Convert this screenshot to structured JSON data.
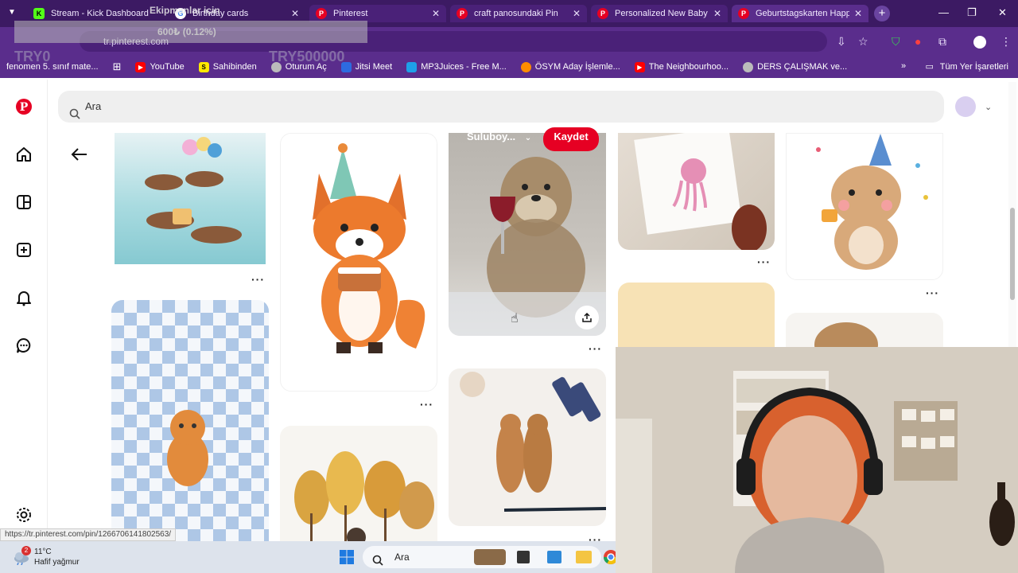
{
  "browser": {
    "tabs": [
      {
        "title": "Stream - Kick Dashboard",
        "fav_letter": "K",
        "fav_color": "#53fc18"
      },
      {
        "title": "Birthday cards",
        "fav_letter": "G",
        "fav_color": "#ffffff"
      },
      {
        "title": "Pinterest",
        "fav_letter": "P",
        "fav_color": "#e60023"
      },
      {
        "title": "craft panosundaki Pin",
        "fav_letter": "P",
        "fav_color": "#e60023"
      },
      {
        "title": "Personalized New Baby Ca",
        "fav_letter": "P",
        "fav_color": "#e60023"
      },
      {
        "title": "Geburtstagskarten Happy",
        "fav_letter": "P",
        "fav_color": "#e60023"
      }
    ],
    "omnibox_text": "tr.pinterest.com",
    "bookmarks": [
      {
        "label": "fenomen 5. sınıf mate...",
        "fav_color": "#ffcc00",
        "letter": ""
      },
      {
        "label": "YouTube",
        "fav_color": "#ff0000",
        "letter": "▶"
      },
      {
        "label": "Sahibinden",
        "fav_color": "#ffe800",
        "letter": "S"
      },
      {
        "label": "Oturum Aç",
        "fav_color": "#cccccc",
        "letter": ""
      },
      {
        "label": "Jitsi Meet",
        "fav_color": "#2d6be0",
        "letter": ""
      },
      {
        "label": "MP3Juices - Free M...",
        "fav_color": "#1ea0e8",
        "letter": ""
      },
      {
        "label": "ÖSYM Aday İşlemle...",
        "fav_color": "#ff8c00",
        "letter": ""
      },
      {
        "label": "The Neighbourhoo...",
        "fav_color": "#ff0000",
        "letter": "▶"
      },
      {
        "label": "DERS ÇALIŞMAK ve...",
        "fav_color": "#cccccc",
        "letter": ""
      }
    ],
    "all_bookmarks": "Tüm Yer İşaretleri"
  },
  "overlay": {
    "heading": "Ekipmanlar için",
    "amount": "600₺ (0.12%)",
    "left_value": "TRY0",
    "right_value": "TRY500000"
  },
  "pinterest": {
    "search_placeholder": "Ara",
    "save_label": "Kaydet",
    "board_name": "Suluboy...",
    "status_url": "https://tr.pinterest.com/pin/1266706141802563/"
  },
  "taskbar": {
    "temperature": "11°C",
    "weather": "Hafif yağmur",
    "search_label": "Ara",
    "notification_count": "2"
  }
}
